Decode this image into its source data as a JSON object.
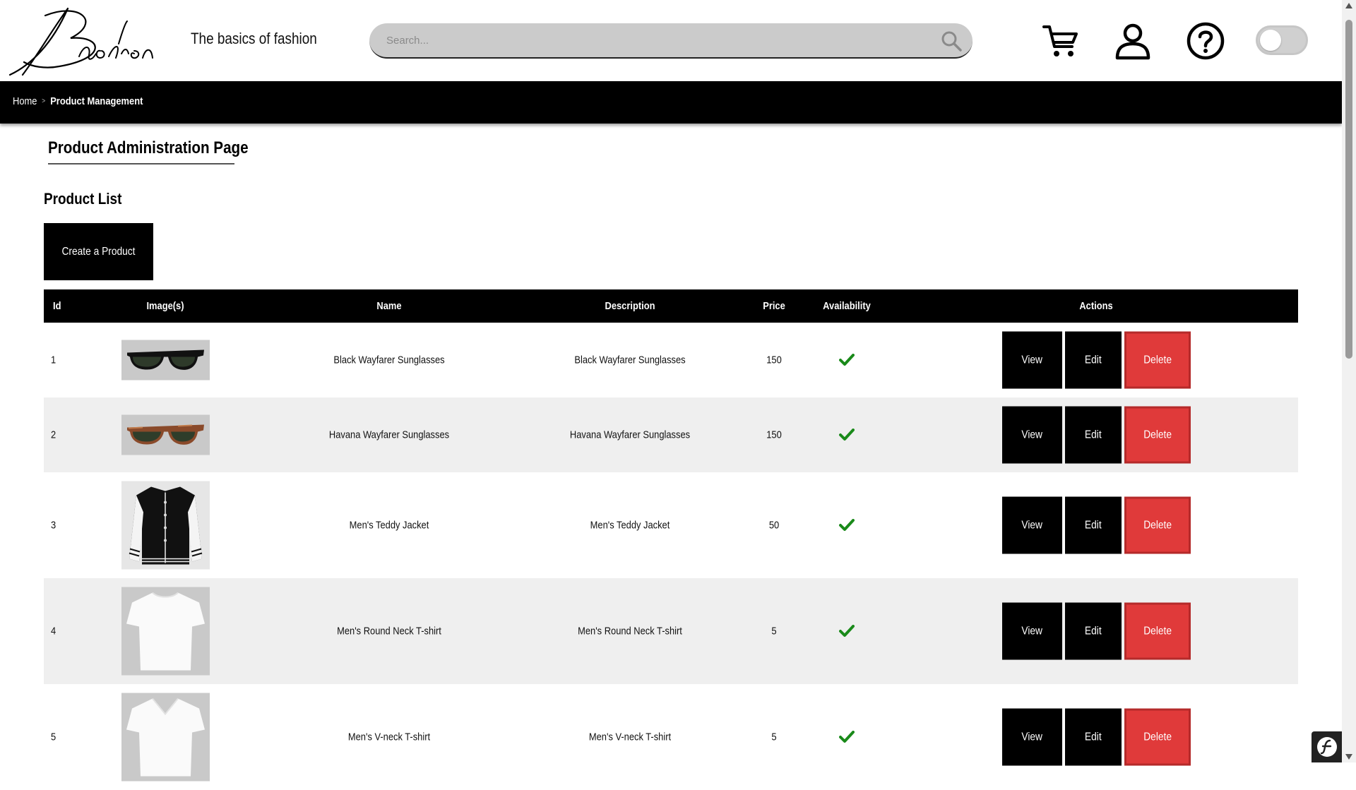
{
  "header": {
    "logo_text": "Bashion",
    "slogan": "The basics of fashion",
    "search_placeholder": "Search...",
    "icons": [
      "search-icon",
      "cart-icon",
      "user-icon",
      "help-icon",
      "theme-toggle"
    ],
    "toggle_on": false
  },
  "breadcrumb": {
    "home": "Home",
    "separator": ">",
    "current": "Product Management"
  },
  "page": {
    "title": "Product Administration Page",
    "list_title": "Product List",
    "create_label": "Create a Product"
  },
  "table": {
    "headers": [
      "Id",
      "Image(s)",
      "Name",
      "Description",
      "Price",
      "Availability",
      "Actions"
    ],
    "actions": {
      "view": "View",
      "edit": "Edit",
      "delete": "Delete"
    },
    "rows": [
      {
        "id": "1",
        "image": "sunglasses-black",
        "name": "Black Wayfarer Sunglasses",
        "description": "Black Wayfarer Sunglasses",
        "price": "150",
        "available": true
      },
      {
        "id": "2",
        "image": "sunglasses-havana",
        "name": "Havana Wayfarer Sunglasses",
        "description": "Havana Wayfarer Sunglasses",
        "price": "150",
        "available": true
      },
      {
        "id": "3",
        "image": "teddy-jacket",
        "name": "Men's Teddy Jacket",
        "description": "Men's Teddy Jacket",
        "price": "50",
        "available": true
      },
      {
        "id": "4",
        "image": "round-neck-tshirt",
        "name": "Men's Round Neck T-shirt",
        "description": "Men's Round Neck T-shirt",
        "price": "5",
        "available": true
      },
      {
        "id": "5",
        "image": "v-neck-tshirt",
        "name": "Men's V-neck T-shirt",
        "description": "Men's V-neck T-shirt",
        "price": "5",
        "available": true
      }
    ]
  },
  "colors": {
    "bar": "#000000",
    "delete": "#e03a3a",
    "check": "#1a8a1a",
    "row_alt": "#efefef",
    "search_bg": "#cbcbcb"
  }
}
